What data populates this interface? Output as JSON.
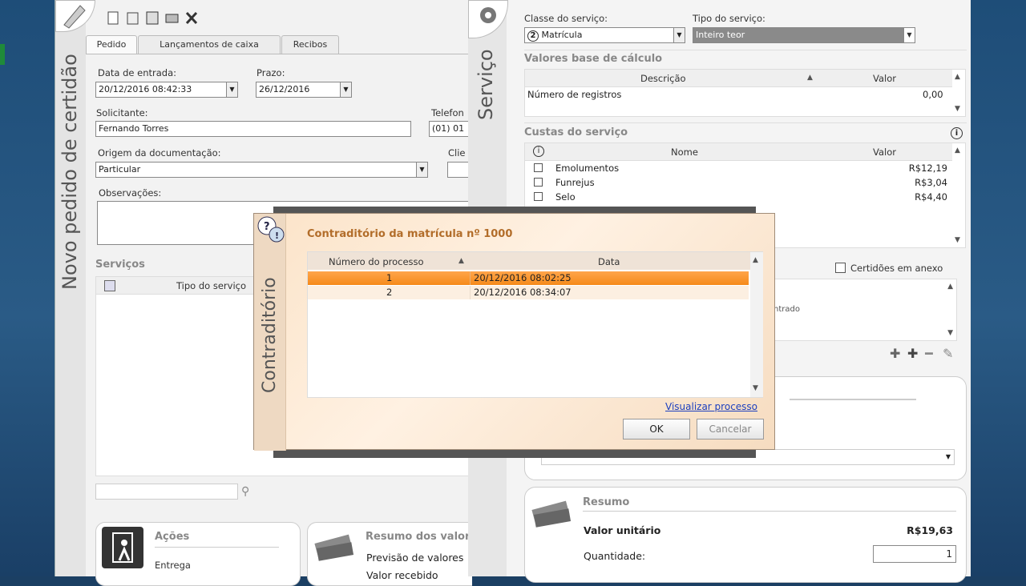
{
  "left_window": {
    "vertical_title": "Novo pedido de certidão",
    "toolbar_icons": [
      "new-doc-icon",
      "open-icon",
      "save-icon",
      "print-icon",
      "delete-icon"
    ],
    "tabs": [
      "Pedido",
      "Lançamentos de caixa",
      "Recibos"
    ],
    "data_entrada_label": "Data de entrada:",
    "data_entrada_value": "20/12/2016  08:42:33",
    "prazo_label": "Prazo:",
    "prazo_value": "26/12/2016",
    "solicitante_label": "Solicitante:",
    "solicitante_value": "Fernando Torres",
    "telefone_label": "Telefon",
    "telefone_value": "(01) 01",
    "origem_label": "Origem da documentação:",
    "origem_value": "Particular",
    "cliente_label": "Clie",
    "observacoes_label": "Observações:",
    "servicos_header": "Serviços",
    "servicos_col": "Tipo do serviço",
    "acoes_title": "Ações",
    "acoes_item": "Entrega",
    "resumo_valores_title": "Resumo dos valor",
    "resumo_valores_item": "Previsão de valores",
    "resumo_valores_item2": "Valor recebido"
  },
  "right_window": {
    "vertical_title": "Serviço",
    "classe_label": "Classe do serviço:",
    "classe_value": "Matrícula",
    "classe_badge": "2",
    "tipo_label": "Tipo do serviço:",
    "tipo_value": "Inteiro teor",
    "valores_base_header": "Valores base de cálculo",
    "vb_col_desc": "Descrição",
    "vb_col_valor": "Valor",
    "vb_row_desc": "Número de registros",
    "vb_row_valor": "0,00",
    "custas_header": "Custas do serviço",
    "custas_col_nome": "Nome",
    "custas_col_valor": "Valor",
    "custas_rows": [
      {
        "nome": "Emolumentos",
        "valor": "R$12,19"
      },
      {
        "nome": "Funrejus",
        "valor": "R$3,04"
      },
      {
        "nome": "Selo",
        "valor": "R$4,40"
      }
    ],
    "certidoes_label": "Certidões em anexo",
    "partial_text": "ntrado",
    "resumo_title": "Resumo",
    "valor_unitario_label": "Valor unitário",
    "valor_unitario_value": "R$19,63",
    "quantidade_label": "Quantidade:",
    "quantidade_value": "1"
  },
  "dialog": {
    "vertical_title": "Contraditório",
    "title": "Contraditório da matrícula nº 1000",
    "col_numero": "Número do processo",
    "col_data": "Data",
    "rows": [
      {
        "numero": "1",
        "data": "20/12/2016 08:02:25"
      },
      {
        "numero": "2",
        "data": "20/12/2016 08:34:07"
      }
    ],
    "link": "Visualizar processo",
    "ok_label": "OK",
    "cancel_label": "Cancelar"
  },
  "colors": {
    "accent_orange": "#f58a1a",
    "dialog_title": "#b26d2a",
    "desktop": "#1e4d78"
  }
}
